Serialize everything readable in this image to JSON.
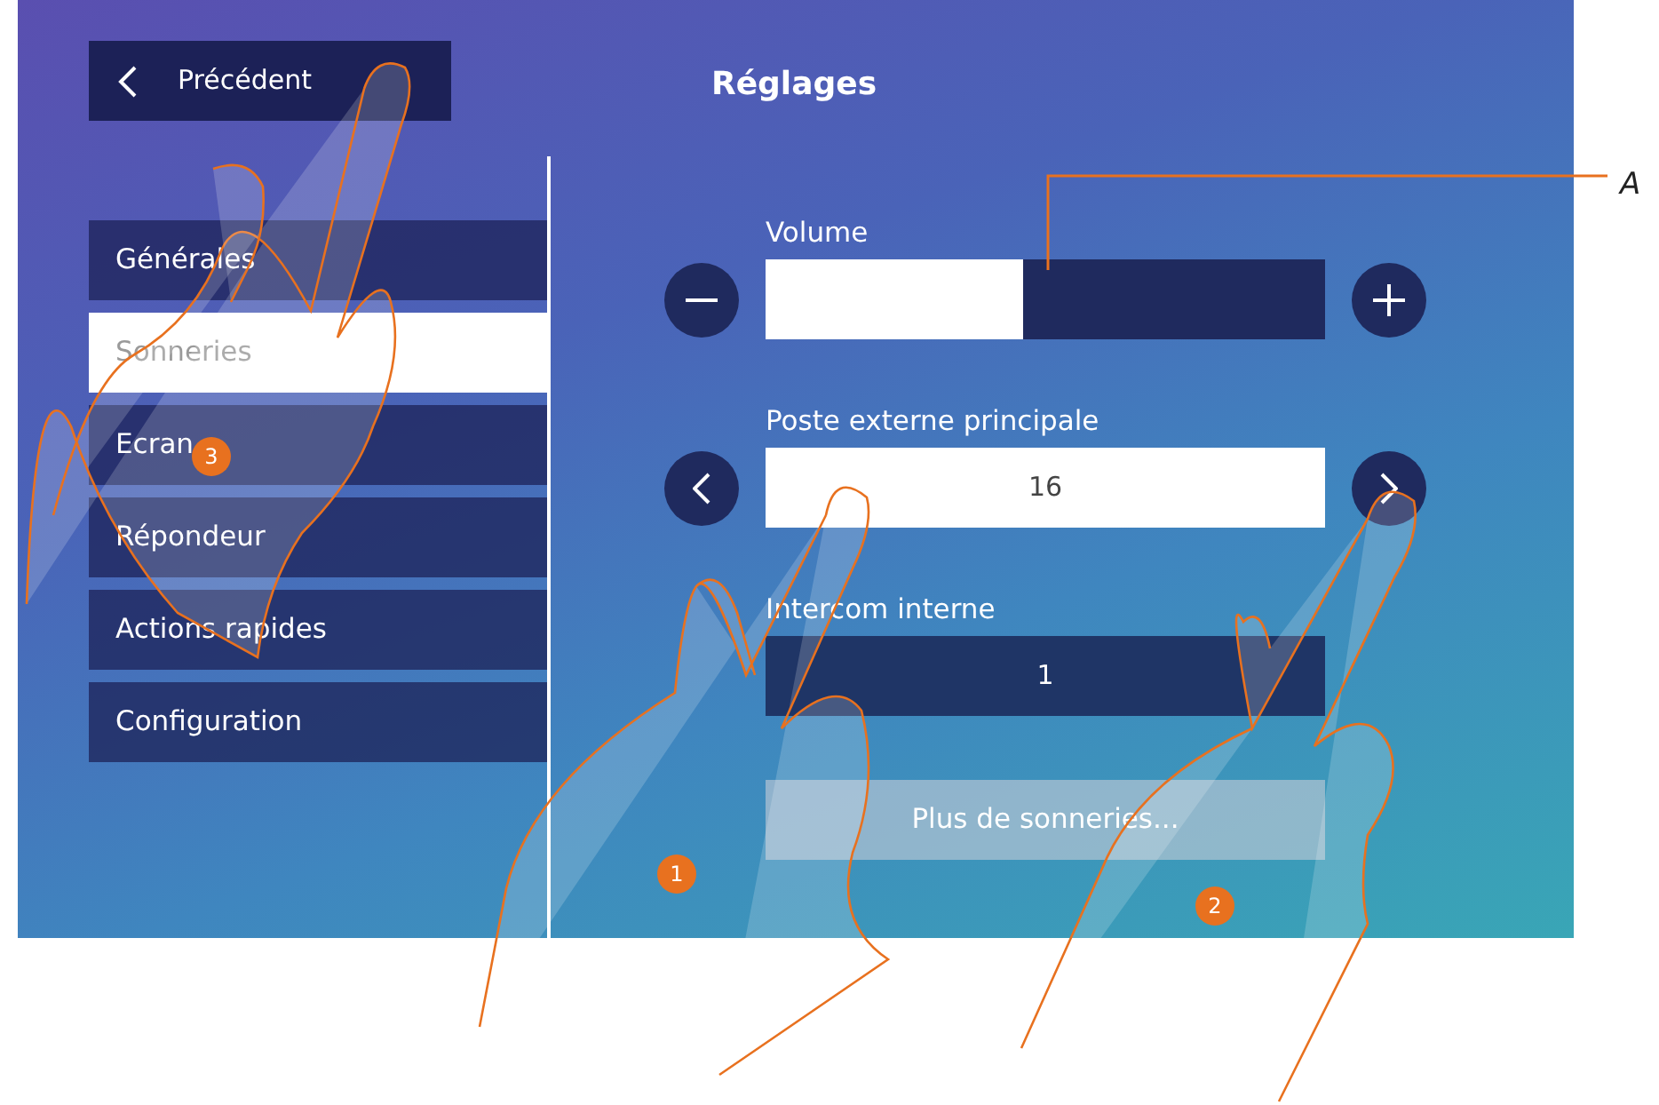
{
  "header": {
    "back_label": "Précédent",
    "title": "Réglages"
  },
  "menu": [
    {
      "label": "Générales",
      "selected": false
    },
    {
      "label": "Sonneries",
      "selected": true
    },
    {
      "label": "Ecran",
      "selected": false
    },
    {
      "label": "Répondeur",
      "selected": false
    },
    {
      "label": "Actions rapides",
      "selected": false
    },
    {
      "label": "Configuration",
      "selected": false
    }
  ],
  "volume": {
    "label": "Volume",
    "level": 0.46
  },
  "settings": [
    {
      "label": "Poste externe principale",
      "value": "16",
      "selected": true
    },
    {
      "label": "Intercom interne",
      "value": "1",
      "selected": false
    }
  ],
  "more_button": "Plus de sonneries...",
  "step_markers": [
    "1",
    "2",
    "3"
  ],
  "annotation": "A"
}
